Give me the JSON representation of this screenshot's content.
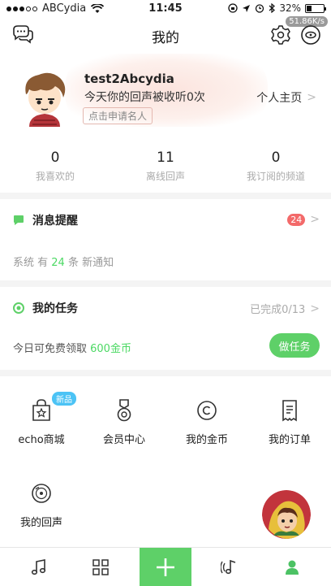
{
  "status_bar": {
    "carrier": "ABCydia",
    "time": "11:45",
    "battery_percent": "32%",
    "battery_level": 0.32,
    "net_speed": "51.86K/s"
  },
  "header": {
    "title": "我的",
    "left_icon": "chat-bubbles-icon",
    "right_icons": [
      "settings-gear-icon",
      "disc-scan-icon"
    ]
  },
  "profile": {
    "username": "test2Abcydia",
    "subtitle": "今天你的回声被收听0次",
    "badge": "点击申请名人",
    "home_link": "个人主页"
  },
  "stats": [
    {
      "value": "0",
      "label": "我喜欢的"
    },
    {
      "value": "11",
      "label": "离线回声"
    },
    {
      "value": "0",
      "label": "我订阅的频道"
    }
  ],
  "messages": {
    "title": "消息提醒",
    "badge_count": "24",
    "sub_prefix": "系统 有 ",
    "sub_count": "24",
    "sub_suffix": " 条 新通知"
  },
  "tasks": {
    "title": "我的任务",
    "progress_text": "已完成0/13",
    "sub_prefix": "今日可免费领取 ",
    "sub_amount": "600金币",
    "button_label": "做任务"
  },
  "grid": [
    {
      "label": "echo商城",
      "icon": "shop-bag-icon",
      "tag": "新品"
    },
    {
      "label": "会员中心",
      "icon": "medal-icon"
    },
    {
      "label": "我的金币",
      "icon": "coin-icon"
    },
    {
      "label": "我的订单",
      "icon": "receipt-icon"
    },
    {
      "label": "我的回声",
      "icon": "record-disc-icon"
    }
  ],
  "tabbar": [
    "music-note-icon",
    "grid-icon",
    "plus-icon",
    "echo-note-icon",
    "profile-icon"
  ],
  "colors": {
    "accent_green": "#5ed068",
    "badge_red": "#f36a6a",
    "new_tag_blue": "#4cc3f5"
  }
}
